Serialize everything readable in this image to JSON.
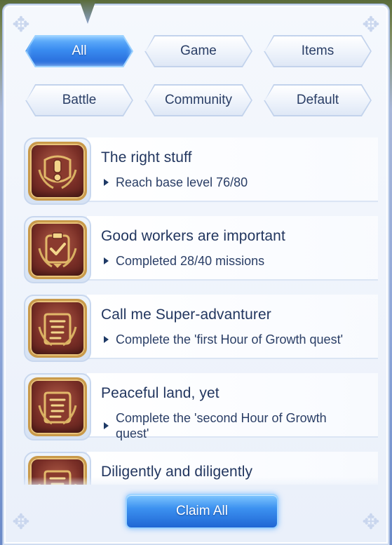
{
  "tabs": [
    {
      "label": "All",
      "active": true
    },
    {
      "label": "Game",
      "active": false
    },
    {
      "label": "Items",
      "active": false
    },
    {
      "label": "Battle",
      "active": false
    },
    {
      "label": "Community",
      "active": false
    },
    {
      "label": "Default",
      "active": false
    }
  ],
  "achievements": [
    {
      "title": "The right stuff",
      "desc": "Reach base level 76/80",
      "icon": "exclamation-badge-icon"
    },
    {
      "title": "Good workers are important",
      "desc": "Completed 28/40 missions",
      "icon": "clipboard-check-icon"
    },
    {
      "title": "Call me Super-advanturer",
      "desc": "Complete the 'first Hour of Growth quest'",
      "icon": "scroll-icon"
    },
    {
      "title": "Peaceful land, yet",
      "desc": "Complete the 'second Hour of Growth quest'",
      "icon": "scroll-icon"
    },
    {
      "title": "Diligently and diligently",
      "desc": "",
      "icon": "scroll-icon"
    }
  ],
  "claim_label": "Claim All",
  "colors": {
    "accent": "#2f7fe8",
    "badge": "#7a2f27",
    "gold": "#c99a4a",
    "text": "#22365f"
  }
}
